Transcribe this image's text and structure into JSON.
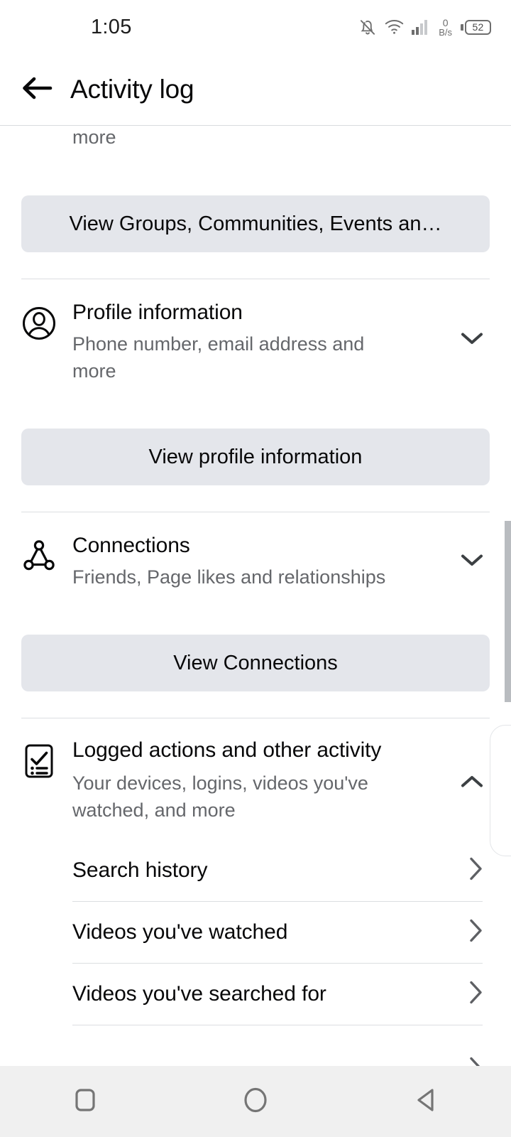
{
  "status_bar": {
    "clock": "1:05",
    "net_speed_value": "0",
    "net_speed_unit": "B/s",
    "battery_level": "52",
    "icons": [
      "notifications-off-icon",
      "wifi-icon",
      "cellular-signal-icon",
      "battery-icon"
    ]
  },
  "app_bar": {
    "back_label": "Back",
    "title": "Activity log"
  },
  "content": {
    "clipped_previous_subtitle": "more",
    "groups_button_label": "View Groups, Communities, Events an…",
    "sections": [
      {
        "icon": "profile-circle-icon",
        "title": "Profile information",
        "subtitle": "Phone number, email address and more",
        "expanded": false,
        "chevron": "chevron-down-icon",
        "button_label": "View profile information"
      },
      {
        "icon": "connections-network-icon",
        "title": "Connections",
        "subtitle": "Friends, Page likes and relationships",
        "expanded": false,
        "chevron": "chevron-down-icon",
        "button_label": "View Connections"
      },
      {
        "icon": "checklist-icon",
        "title": "Logged actions and other activity",
        "subtitle": "Your devices, logins, videos you've watched, and more",
        "expanded": true,
        "chevron": "chevron-up-icon"
      }
    ],
    "logged_actions_items": [
      {
        "label": "Search history",
        "chevron": "chevron-right-icon"
      },
      {
        "label": "Videos you've watched",
        "chevron": "chevron-right-icon"
      },
      {
        "label": "Videos you've searched for",
        "chevron": "chevron-right-icon"
      }
    ]
  },
  "nav_bar": {
    "recents_label": "Recents",
    "home_label": "Home",
    "back_label": "Back"
  },
  "colors": {
    "background": "#ffffff",
    "button_bg": "#e4e6eb",
    "primary_text": "#080809",
    "secondary_text": "#65676b",
    "divider": "#dcdee1",
    "navbar_bg": "#f0f0f0",
    "scrollbar": "#b9bcc0"
  }
}
